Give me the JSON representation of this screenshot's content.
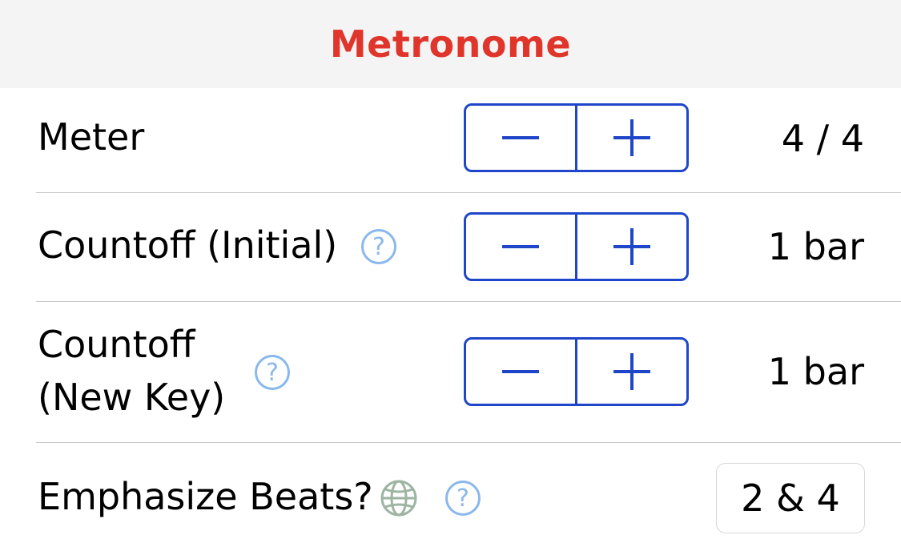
{
  "header": {
    "title": "Metronome"
  },
  "rows": [
    {
      "label": "Meter",
      "value": "4 / 4"
    },
    {
      "label": "Countoff (Initial)",
      "value": "1 bar"
    },
    {
      "label_line1": "Countoff",
      "label_line2": "(New Key)",
      "value": "1 bar"
    },
    {
      "label": "Emphasize Beats?",
      "value": "2 & 4"
    }
  ],
  "help_glyph": "?",
  "icons": {
    "minus": "minus-icon",
    "plus": "plus-icon",
    "help": "help-circle-icon",
    "globe": "globe-icon"
  },
  "colors": {
    "title": "#e0352b",
    "stepper": "#1f46c9",
    "help": "#8ab8ec",
    "globe": "#9db5a2",
    "header_bg": "#f4f4f4"
  }
}
